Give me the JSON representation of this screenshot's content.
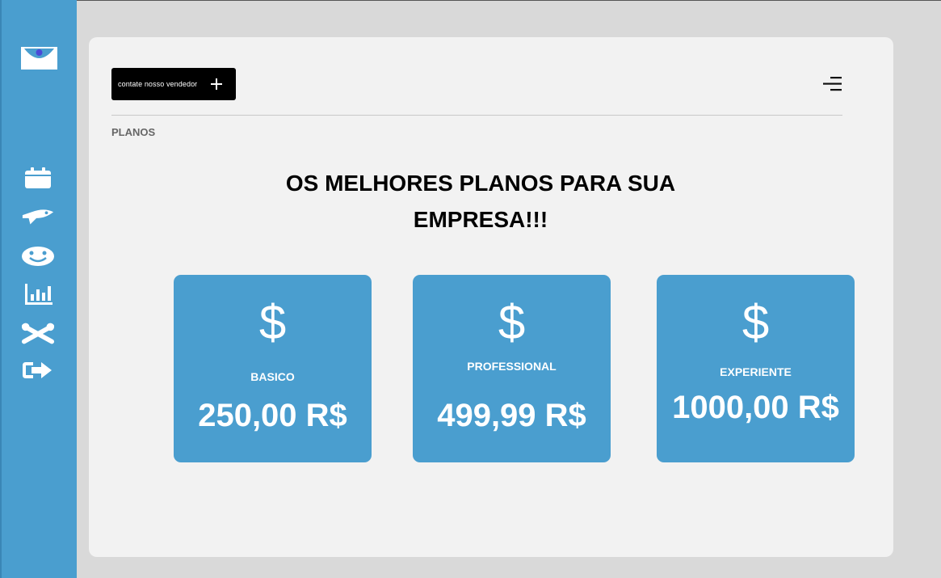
{
  "sidebar": {
    "logo": "eye-logo",
    "items": [
      {
        "icon": "calendar-icon"
      },
      {
        "icon": "rocket-icon"
      },
      {
        "icon": "smiley-icon"
      },
      {
        "icon": "bar-chart-icon"
      },
      {
        "icon": "tools-icon"
      },
      {
        "icon": "sign-out-icon"
      }
    ]
  },
  "header": {
    "contact_label": "contate nosso vendedor",
    "contact_icon": "plus-icon",
    "menu_icon": "menu-icon"
  },
  "breadcrumb": "PLANOS",
  "headline": "OS MELHORES PLANOS PARA SUA EMPRESA!!!",
  "plans": [
    {
      "symbol": "$",
      "name": "BASICO",
      "price": "250,00 R$"
    },
    {
      "symbol": "$",
      "name": "PROFESSIONAL",
      "price": "499,99 R$"
    },
    {
      "symbol": "$",
      "name": "EXPERIENTE",
      "price": "1000,00 R$"
    }
  ],
  "colors": {
    "accent": "#4a9ecf",
    "button": "#000000",
    "panel": "#f2f2f2",
    "background": "#d9d9d9"
  }
}
